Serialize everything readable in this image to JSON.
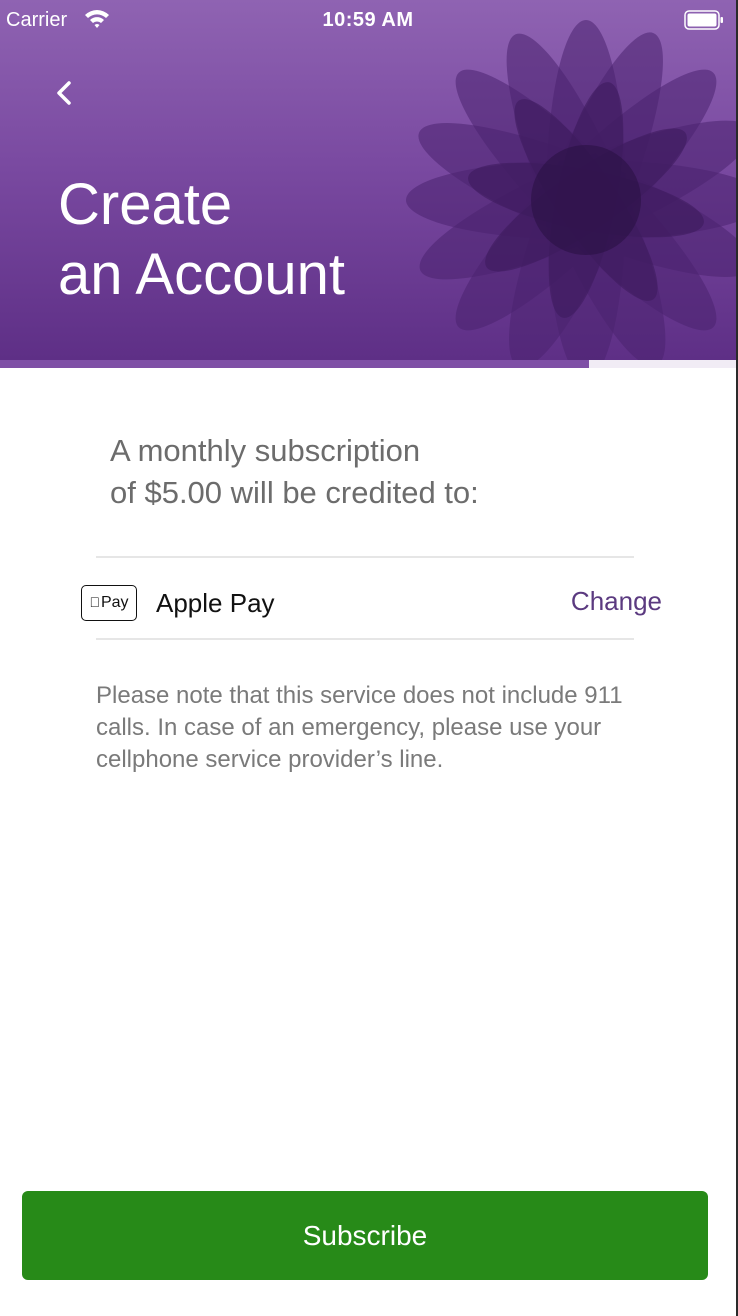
{
  "status_bar": {
    "carrier": "Carrier",
    "time": "10:59 AM"
  },
  "header": {
    "title_line1": "Create",
    "title_line2": "an Account",
    "progress_fraction": 0.8
  },
  "subscription": {
    "line1": "A monthly subscription",
    "line2": "of $5.00 will be credited to:"
  },
  "payment": {
    "badge_text": "Pay",
    "method_label": "Apple Pay",
    "change_label": "Change"
  },
  "note": "Please note that this service does not include 911 calls. In case of an emergency, please use your cellphone service provider’s line.",
  "subscribe_label": "Subscribe",
  "colors": {
    "header": "#7a4aa1",
    "accent": "#5b3a80",
    "button": "#278a18"
  },
  "icons": [
    "wifi-icon",
    "battery-icon",
    "back-chevron-icon",
    "apple-logo-icon"
  ]
}
